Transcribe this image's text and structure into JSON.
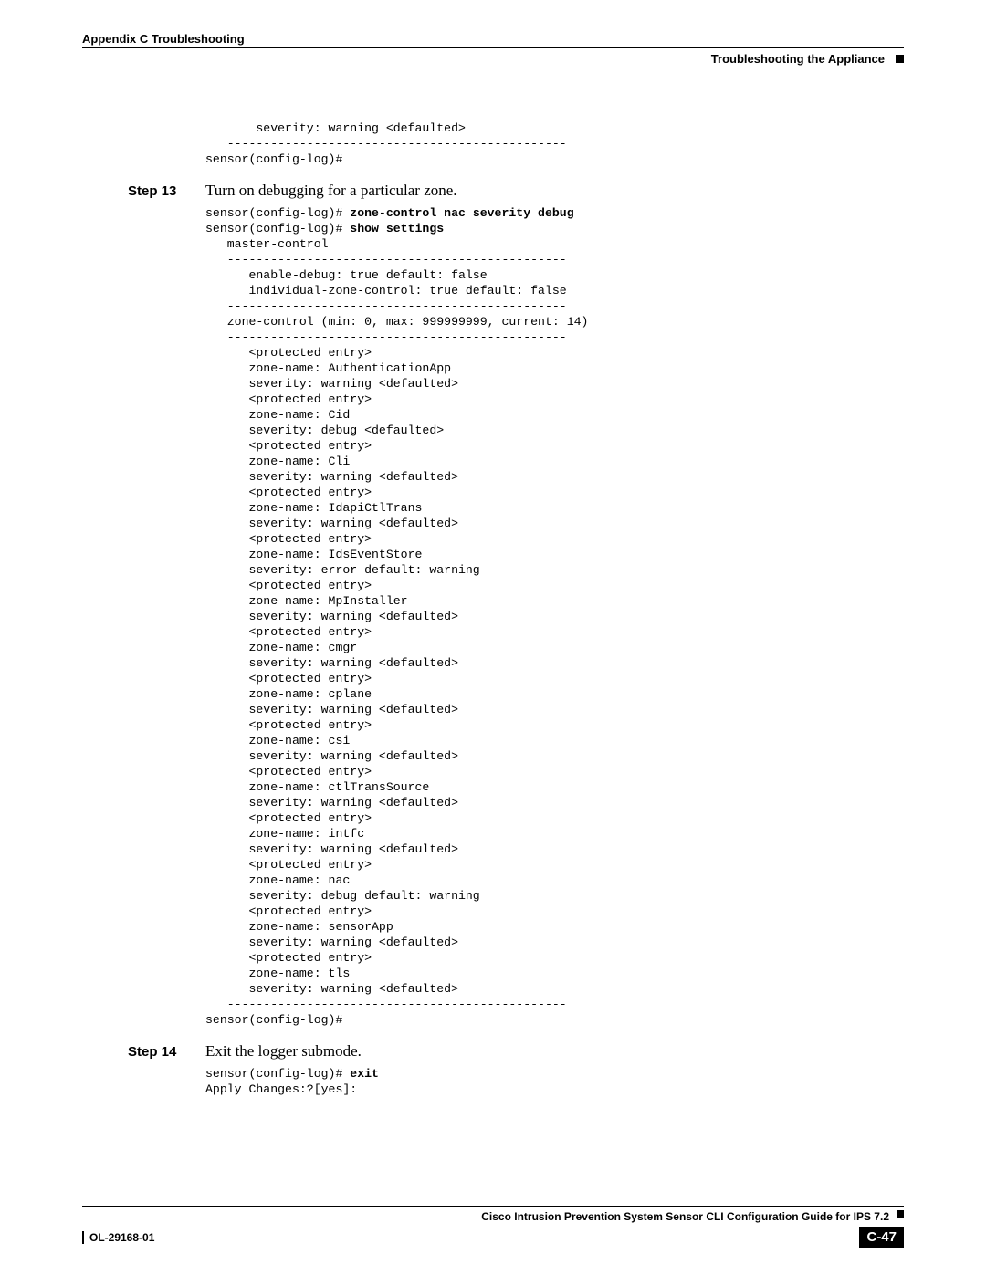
{
  "header": {
    "chapter": "Appendix C      Troubleshooting",
    "section": "Troubleshooting the Appliance"
  },
  "block1": {
    "lines": [
      "       severity: warning <defaulted>",
      "   -----------------------------------------------",
      "sensor(config-log)#"
    ]
  },
  "step13": {
    "label": "Step 13",
    "text": "Turn on debugging for a particular zone."
  },
  "block13": {
    "prompt1": "sensor(config-log)# ",
    "cmd1": "zone-control nac severity debug",
    "prompt2": "sensor(config-log)# ",
    "cmd2": "show settings",
    "body": [
      "   master-control",
      "   -----------------------------------------------",
      "      enable-debug: true default: false",
      "      individual-zone-control: true default: false",
      "   -----------------------------------------------",
      "   zone-control (min: 0, max: 999999999, current: 14)",
      "   -----------------------------------------------",
      "      <protected entry>",
      "      zone-name: AuthenticationApp",
      "      severity: warning <defaulted>",
      "      <protected entry>",
      "      zone-name: Cid",
      "      severity: debug <defaulted>",
      "      <protected entry>",
      "      zone-name: Cli",
      "      severity: warning <defaulted>",
      "      <protected entry>",
      "      zone-name: IdapiCtlTrans",
      "      severity: warning <defaulted>",
      "      <protected entry>",
      "      zone-name: IdsEventStore",
      "      severity: error default: warning",
      "      <protected entry>",
      "      zone-name: MpInstaller",
      "      severity: warning <defaulted>",
      "      <protected entry>",
      "      zone-name: cmgr",
      "      severity: warning <defaulted>",
      "      <protected entry>",
      "      zone-name: cplane",
      "      severity: warning <defaulted>",
      "      <protected entry>",
      "      zone-name: csi",
      "      severity: warning <defaulted>",
      "      <protected entry>",
      "      zone-name: ctlTransSource",
      "      severity: warning <defaulted>",
      "      <protected entry>",
      "      zone-name: intfc",
      "      severity: warning <defaulted>",
      "      <protected entry>",
      "      zone-name: nac",
      "      severity: debug default: warning",
      "      <protected entry>",
      "      zone-name: sensorApp",
      "      severity: warning <defaulted>",
      "      <protected entry>",
      "      zone-name: tls",
      "      severity: warning <defaulted>",
      "   -----------------------------------------------",
      "sensor(config-log)#"
    ]
  },
  "step14": {
    "label": "Step 14",
    "text": "Exit the logger submode."
  },
  "block14": {
    "prompt": "sensor(config-log)# ",
    "cmd": "exit",
    "body": "Apply Changes:?[yes]:"
  },
  "footer": {
    "guide": "Cisco Intrusion Prevention System Sensor CLI Configuration Guide for IPS 7.2",
    "docnum": "OL-29168-01",
    "pagenum": "C-47"
  }
}
